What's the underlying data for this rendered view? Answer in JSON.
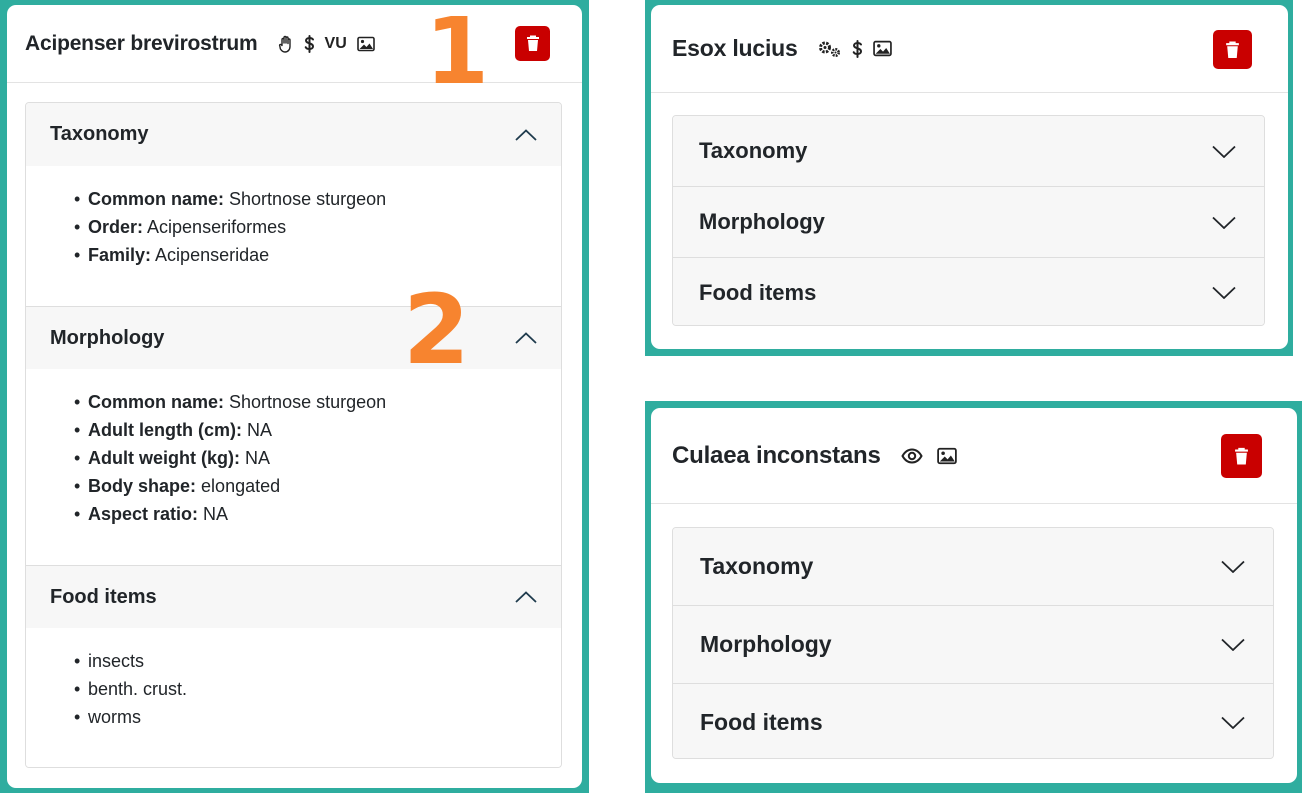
{
  "colors": {
    "frame": "#2fad9f",
    "delete": "#c90000",
    "marker": "#f7842f",
    "accordion_header": "#f7f7f7"
  },
  "markers": [
    "1",
    "2"
  ],
  "cards": [
    {
      "title": "Acipenser brevirostrum",
      "badges": [
        {
          "icon": "hand-icon"
        },
        {
          "icon": "dollar-icon"
        },
        {
          "text": "VU"
        },
        {
          "icon": "image-icon"
        }
      ],
      "sections": [
        {
          "title": "Taxonomy",
          "expanded": true,
          "items": [
            {
              "label": "Common name:",
              "value": "Shortnose sturgeon"
            },
            {
              "label": "Order:",
              "value": "Acipenseriformes"
            },
            {
              "label": "Family:",
              "value": "Acipenseridae"
            }
          ]
        },
        {
          "title": "Morphology",
          "expanded": true,
          "items": [
            {
              "label": "Common name:",
              "value": "Shortnose sturgeon"
            },
            {
              "label": "Adult length (cm):",
              "value": "NA"
            },
            {
              "label": "Adult weight (kg):",
              "value": "NA"
            },
            {
              "label": "Body shape:",
              "value": "elongated"
            },
            {
              "label": "Aspect ratio:",
              "value": "NA"
            }
          ]
        },
        {
          "title": "Food items",
          "expanded": true,
          "items": [
            {
              "value": "insects"
            },
            {
              "value": "benth. crust."
            },
            {
              "value": "worms"
            }
          ]
        }
      ]
    },
    {
      "title": "Esox lucius",
      "badges": [
        {
          "icon": "gears-icon"
        },
        {
          "icon": "dollar-icon"
        },
        {
          "icon": "image-icon"
        }
      ],
      "sections": [
        {
          "title": "Taxonomy",
          "expanded": false
        },
        {
          "title": "Morphology",
          "expanded": false
        },
        {
          "title": "Food items",
          "expanded": false
        }
      ]
    },
    {
      "title": "Culaea inconstans",
      "badges": [
        {
          "icon": "eye-icon"
        },
        {
          "icon": "image-icon"
        }
      ],
      "sections": [
        {
          "title": "Taxonomy",
          "expanded": false
        },
        {
          "title": "Morphology",
          "expanded": false
        },
        {
          "title": "Food items",
          "expanded": false
        }
      ]
    }
  ]
}
